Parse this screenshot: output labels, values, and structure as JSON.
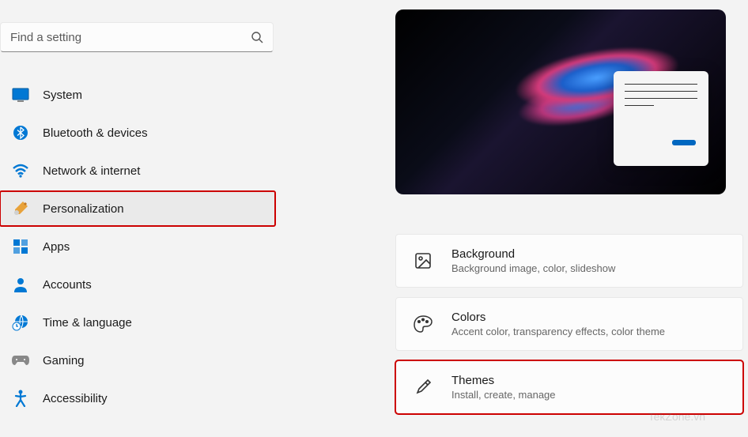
{
  "search": {
    "placeholder": "Find a setting"
  },
  "sidebar": {
    "items": [
      {
        "key": "system",
        "label": "System"
      },
      {
        "key": "bluetooth",
        "label": "Bluetooth & devices"
      },
      {
        "key": "network",
        "label": "Network & internet"
      },
      {
        "key": "personalization",
        "label": "Personalization"
      },
      {
        "key": "apps",
        "label": "Apps"
      },
      {
        "key": "accounts",
        "label": "Accounts"
      },
      {
        "key": "time",
        "label": "Time & language"
      },
      {
        "key": "gaming",
        "label": "Gaming"
      },
      {
        "key": "accessibility",
        "label": "Accessibility"
      }
    ]
  },
  "cards": {
    "background": {
      "title": "Background",
      "sub": "Background image, color, slideshow"
    },
    "colors": {
      "title": "Colors",
      "sub": "Accent color, transparency effects, color theme"
    },
    "themes": {
      "title": "Themes",
      "sub": "Install, create, manage"
    }
  },
  "watermark": "TekZone.vn"
}
